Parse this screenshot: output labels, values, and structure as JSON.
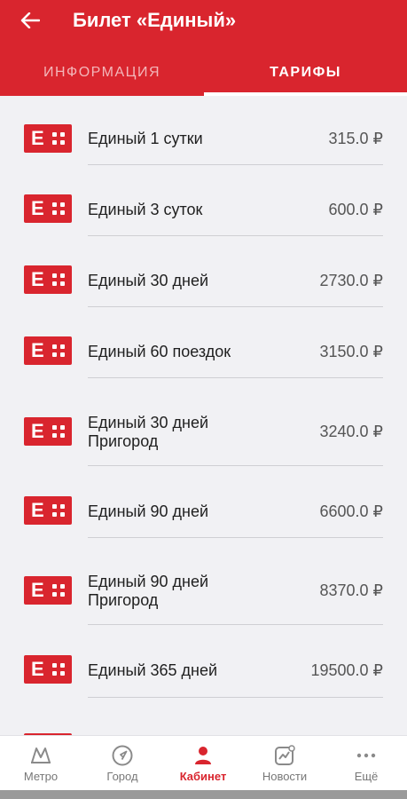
{
  "header": {
    "title": "Билет «Единый»",
    "tabs": [
      {
        "label": "ИНФОРМАЦИЯ",
        "active": false
      },
      {
        "label": "ТАРИФЫ",
        "active": true
      }
    ]
  },
  "tariffs": [
    {
      "name": "Единый 1 сутки",
      "price": "315.0 ₽"
    },
    {
      "name": "Единый 3 суток",
      "price": "600.0 ₽"
    },
    {
      "name": "Единый 30 дней",
      "price": "2730.0 ₽"
    },
    {
      "name": "Единый 60 поездок",
      "price": "3150.0 ₽"
    },
    {
      "name": "Единый 30 дней\nПригород",
      "price": "3240.0 ₽"
    },
    {
      "name": "Единый 90 дней",
      "price": "6600.0 ₽"
    },
    {
      "name": "Единый 90 дней\nПригород",
      "price": "8370.0 ₽"
    },
    {
      "name": "Единый 365 дней",
      "price": "19500.0 ₽"
    }
  ],
  "logo_letter": "Е",
  "colors": {
    "brand": "#d9252e",
    "background": "#f1f1f4",
    "text": "#1f1f1f",
    "price": "#555555"
  },
  "bottom_nav": [
    {
      "label": "Метро",
      "icon": "metro-icon",
      "active": false
    },
    {
      "label": "Город",
      "icon": "navigation-icon",
      "active": false
    },
    {
      "label": "Кабинет",
      "icon": "profile-icon",
      "active": true
    },
    {
      "label": "Новости",
      "icon": "news-icon",
      "active": false
    },
    {
      "label": "Ещё",
      "icon": "more-icon",
      "active": false
    }
  ]
}
